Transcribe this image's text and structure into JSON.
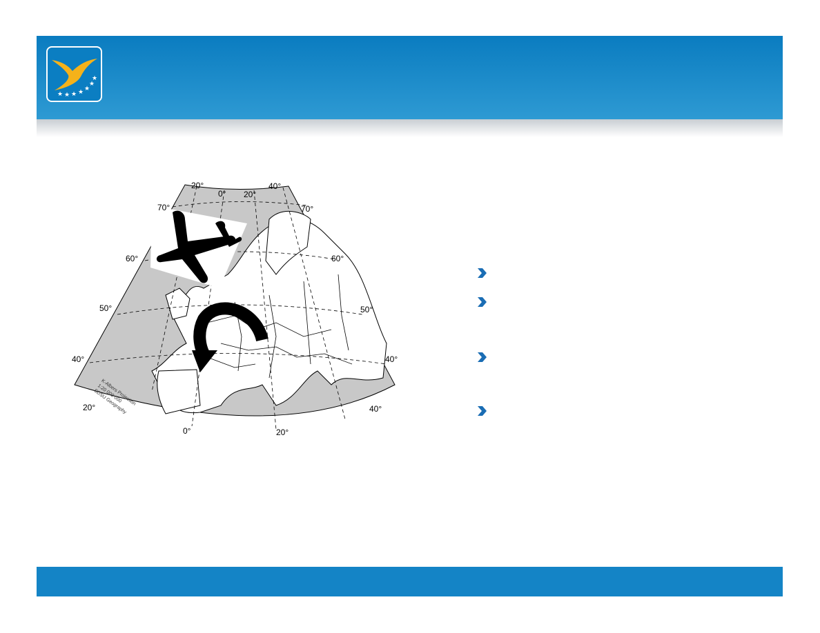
{
  "map": {
    "graticule_labels": {
      "top": [
        "20°",
        "0°",
        "20°",
        "40°"
      ],
      "left_lat": [
        "70°",
        "60°",
        "50°",
        "40°"
      ],
      "right_lat": [
        "70°",
        "60°",
        "50°",
        "40°"
      ],
      "bottom": [
        "20°",
        "0°",
        "20°",
        "40°"
      ]
    },
    "credit_lines": [
      "K-Albers Projection",
      "1:20 000 000",
      "SDSU Geography"
    ]
  },
  "icons": {
    "logo": "easa-bird-logo",
    "airplane": "airplane-icon",
    "arrow": "curved-arrow-icon",
    "bullet": "chevron-right-icon"
  },
  "colors": {
    "header": "#0a7cc0",
    "footer": "#1484c6",
    "sea": "#c8c8c8",
    "bullet": "#1a6db4",
    "logo_bird": "#f5b21a"
  },
  "bullets": [
    "",
    "",
    "",
    ""
  ]
}
